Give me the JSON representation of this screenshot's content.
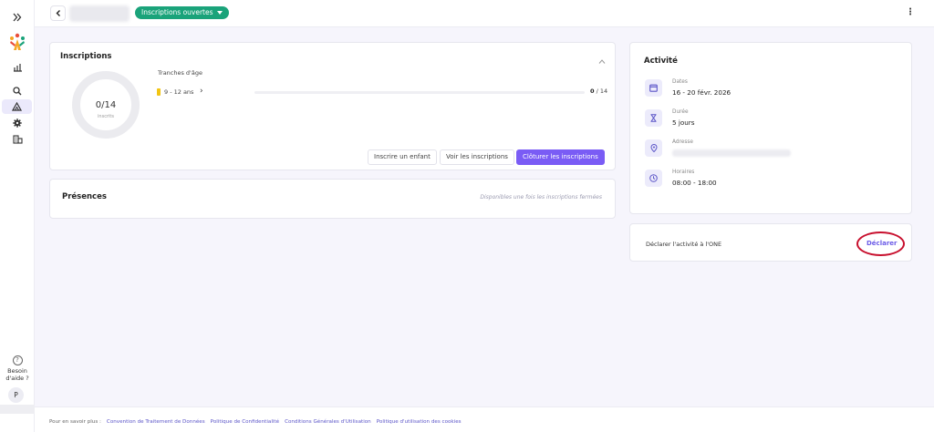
{
  "header": {
    "status_label": "Inscriptions ouvertes"
  },
  "sidebar": {
    "help_line1": "Besoin",
    "help_line2": "d'aide ?",
    "avatar_initial": "P"
  },
  "inscriptions": {
    "title": "Inscriptions",
    "count_display": "0/14",
    "count_sub": "inscrits",
    "tranches_label": "Tranches d'âge",
    "age_range": "9 - 12 ans",
    "age_filled": "0",
    "age_total": "/ 14",
    "progress_fraction": 0,
    "buttons": {
      "inscrire": "Inscrire un enfant",
      "voir": "Voir les inscriptions",
      "cloturer": "Clôturer les inscriptions"
    }
  },
  "presences": {
    "title": "Présences",
    "note": "Disponibles une fois les inscriptions fermées"
  },
  "activite": {
    "title": "Activité",
    "dates_label": "Dates",
    "dates_value": "16 - 20 févr. 2026",
    "duree_label": "Durée",
    "duree_value": "5 jours",
    "adresse_label": "Adresse",
    "horaires_label": "Horaires",
    "horaires_value": "08:00 - 18:00"
  },
  "declaration": {
    "text": "Déclarer l'activité à l'ONE",
    "link": "Déclarer"
  },
  "footer": {
    "prefix": "Pour en savoir plus :",
    "links": [
      "Convention de Traitement de Données",
      "Politique de Confidentialité",
      "Conditions Générales d'Utilisation",
      "Politique d'utilisation des cookies"
    ]
  },
  "colors": {
    "accent": "#7a5cf5",
    "status_green": "#1aa37a",
    "age_yellow": "#f2c513",
    "annotation_red": "#c8102e"
  }
}
